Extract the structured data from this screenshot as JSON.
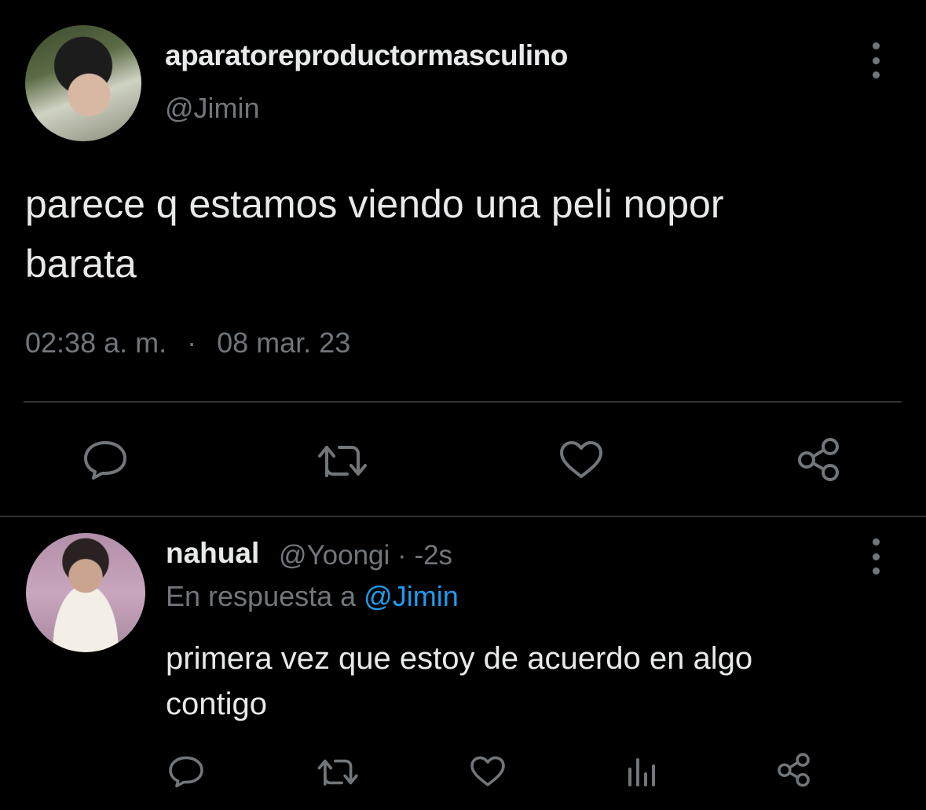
{
  "main_tweet": {
    "display_name": "aparatoreproductormasculino",
    "handle": "@Jimin",
    "text_line1": "parece q estamos viendo una peli nopor",
    "text_line2": "barata",
    "time": "02:38 a. m.",
    "separator": "·",
    "date": "08 mar. 23",
    "actions": [
      "reply-icon",
      "retweet-icon",
      "like-icon",
      "share-icon"
    ]
  },
  "reply_tweet": {
    "display_name": "nahual",
    "handle": "@Yoongi",
    "separator": "·",
    "age": "-2s",
    "reply_prefix": "En respuesta a",
    "reply_mention": "@Jimin",
    "text_line1": "primera vez que estoy de acuerdo en algo",
    "text_line2": "contigo",
    "actions": [
      "reply-icon",
      "retweet-icon",
      "like-icon",
      "views-icon",
      "share-icon"
    ]
  },
  "colors": {
    "background": "#000000",
    "text": "#e7e9ea",
    "secondary": "#71767b",
    "accent": "#1d9bf0",
    "divider": "#2f3336"
  }
}
